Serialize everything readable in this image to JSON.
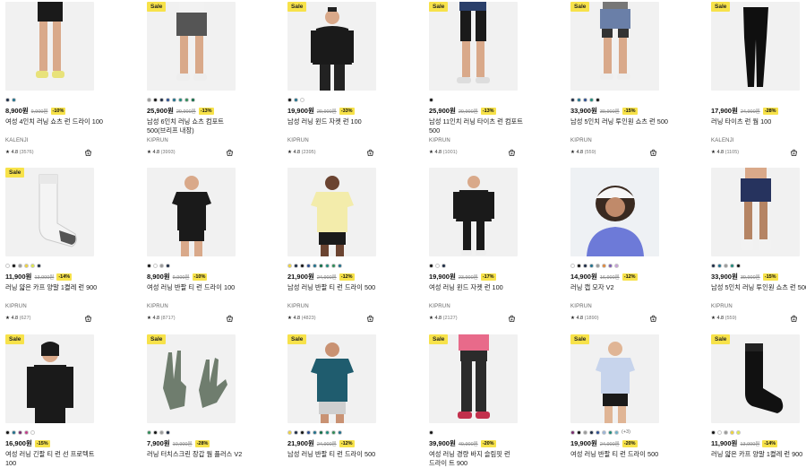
{
  "sale_badge": "Sale",
  "products": [
    {
      "sale": false,
      "price": "8,900원",
      "old": "9,900원",
      "disc": "-10%",
      "name": "여성 4인치 러닝 쇼츠 런 드라이 100",
      "brand": "KALENJI",
      "rating": "★ 4.8",
      "reviews": "(3576)",
      "swatches": [
        "#1b2a44",
        "#1f6f8b"
      ],
      "art": "shorts-legs"
    },
    {
      "sale": true,
      "price": "25,900원",
      "old": "29,900원",
      "disc": "-13%",
      "name": "남성 6인치 러닝 쇼츠 컴포트 500(브리프 내장)",
      "brand": "KIPRUN",
      "rating": "★ 4.8",
      "reviews": "(3993)",
      "swatches": [
        "#9a9a9a",
        "#111111",
        "#1b2a44",
        "#2a4d8f",
        "#1f6f8b",
        "#1e8a7a",
        "#2e8b57",
        "#0f6b45"
      ],
      "art": "shorts-man"
    },
    {
      "sale": true,
      "price": "19,900원",
      "old": "29,900원",
      "disc": "-33%",
      "name": "남성 러닝 윈드 자켓 런 100",
      "brand": "KIPRUN",
      "rating": "★ 4.8",
      "reviews": "(2395)",
      "swatches": [
        "#111111",
        "#1f6f8b",
        "#ffffff"
      ],
      "art": "jacket-man"
    },
    {
      "sale": true,
      "price": "25,900원",
      "old": "29,900원",
      "disc": "-13%",
      "name": "남성 11인치 러닝 타이츠 런 컴포트 500",
      "brand": "KIPRUN",
      "rating": "★ 4.8",
      "reviews": "(1001)",
      "swatches": [
        "#111111"
      ],
      "art": "tights-legs"
    },
    {
      "sale": true,
      "price": "33,900원",
      "old": "39,900원",
      "disc": "-15%",
      "name": "남성 5인치 러닝 투인원 쇼츠 런 500",
      "brand": "KIPRUN",
      "rating": "★ 4.8",
      "reviews": "(559)",
      "swatches": [
        "#1b2a44",
        "#1f6f8b",
        "#2a4d8f",
        "#1e8a7a",
        "#111111"
      ],
      "art": "twoinone-legs"
    },
    {
      "sale": true,
      "price": "17,900원",
      "old": "24,900원",
      "disc": "-28%",
      "name": "러닝 타이츠 런 웜 100",
      "brand": "KALENJI",
      "rating": "★ 4.8",
      "reviews": "(1105)",
      "swatches": [],
      "art": "black-tights"
    },
    {
      "sale": true,
      "price": "11,900원",
      "old": "13,900원",
      "disc": "-14%",
      "name": "러닝 얇은 카프 양말 1켤레 런 900",
      "brand": "KIPRUN",
      "rating": "★ 4.8",
      "reviews": "(627)",
      "swatches": [
        "#ffffff",
        "#111111",
        "#9a9a9a",
        "#f0d33a",
        "#dfe94b",
        "#1b2a44"
      ],
      "art": "white-sock"
    },
    {
      "sale": false,
      "price": "8,900원",
      "old": "9,900원",
      "disc": "-10%",
      "name": "여성 러닝 반팔 티 런 드라이 100",
      "brand": "KIPRUN",
      "rating": "★ 4.8",
      "reviews": "(8717)",
      "swatches": [
        "#111111",
        "#ffffff",
        "#9a9a9a",
        "#1b2a44"
      ],
      "art": "woman-tee"
    },
    {
      "sale": false,
      "price": "21,900원",
      "old": "24,900원",
      "disc": "-12%",
      "name": "남성 러닝 반팔 티 런 드라이 500",
      "brand": "KIPRUN",
      "rating": "★ 4.8",
      "reviews": "(4823)",
      "swatches": [
        "#f0d33a",
        "#1b2a44",
        "#111111",
        "#2a4d8f",
        "#1f6f8b",
        "#0f6b45",
        "#1e8a7a",
        "#2e8b57",
        "#1f6f8b"
      ],
      "art": "man-yellow"
    },
    {
      "sale": false,
      "price": "19,900원",
      "old": "23,900원",
      "disc": "-17%",
      "name": "여성 러닝 윈드 자켓 런 100",
      "brand": "KIPRUN",
      "rating": "★ 4.8",
      "reviews": "(2127)",
      "swatches": [
        "#111111",
        "#ffffff",
        "#1b2a44"
      ],
      "art": "woman-jacket"
    },
    {
      "sale": false,
      "price": "14,900원",
      "old": "16,900원",
      "disc": "-12%",
      "name": "러닝 캡 모자 V2",
      "brand": "KIPRUN",
      "rating": "★ 4.8",
      "reviews": "(1890)",
      "swatches": [
        "#ffffff",
        "#111111",
        "#1b2a44",
        "#1f6f8b",
        "#9a9a9a",
        "#e0873a",
        "#7a5bb0",
        "#c7a0d8"
      ],
      "art": "woman-cap"
    },
    {
      "sale": false,
      "price": "33,900원",
      "old": "39,900원",
      "disc": "-15%",
      "name": "남성 5인치 러닝 투인원 쇼츠 런 500",
      "brand": "KIPRUN",
      "rating": "★ 4.8",
      "reviews": "(559)",
      "swatches": [
        "#1b2a44",
        "#1f6f8b",
        "#9a9a9a",
        "#1e8a7a",
        "#111111"
      ],
      "art": "twoinone-navy"
    },
    {
      "sale": true,
      "price": "16,900원",
      "old": "",
      "disc": "-15%",
      "name": "여성 러닝 긴팔 티 런 선 프로텍트 100",
      "brand": "",
      "rating": "",
      "reviews": "",
      "swatches": [
        "#111111",
        "#1f6f8b",
        "#7a2b6e",
        "#c23f8a",
        "#ffffff"
      ],
      "art": "woman-longsleeve"
    },
    {
      "sale": true,
      "price": "7,900원",
      "old": "10,900원",
      "disc": "-28%",
      "name": "러닝 터치스크린 장갑 웜 플러스 V2",
      "brand": "",
      "rating": "",
      "reviews": "",
      "swatches": [
        "#2e8b57",
        "#111111",
        "#9a9a9a",
        "#1b2a44"
      ],
      "art": "gloves"
    },
    {
      "sale": true,
      "price": "21,900원",
      "old": "24,900원",
      "disc": "-12%",
      "name": "남성 러닝 반팔 티 런 드라이 500",
      "brand": "",
      "rating": "",
      "reviews": "",
      "swatches": [
        "#f0d33a",
        "#1b2a44",
        "#111111",
        "#2a4d8f",
        "#1f6f8b",
        "#0f6b45",
        "#1e8a7a",
        "#2e8b57",
        "#1f6f8b"
      ],
      "art": "man-teal"
    },
    {
      "sale": true,
      "price": "39,900원",
      "old": "49,900원",
      "disc": "-20%",
      "name": "여성 러닝 경량 바지 슬림핏 런 드라이 트 900",
      "brand": "",
      "rating": "",
      "reviews": "",
      "swatches": [
        "#111111"
      ],
      "art": "woman-pants"
    },
    {
      "sale": true,
      "price": "19,900원",
      "old": "24,900원",
      "disc": "-20%",
      "name": "여성 러닝 반팔 티 런 드라이 500",
      "brand": "",
      "rating": "",
      "reviews": "",
      "swatches": [
        "#7a2b6e",
        "#111111",
        "#9a9a9a",
        "#1b2a44",
        "#2a4d8f",
        "#9bb5d8",
        "#1e8a7a",
        "#6fb0c8"
      ],
      "more": "(+3)",
      "art": "woman-lightblue"
    },
    {
      "sale": true,
      "price": "11,900원",
      "old": "13,900원",
      "disc": "-14%",
      "name": "러닝 얇은 카프 양말 1켤레 런 900",
      "brand": "",
      "rating": "",
      "reviews": "",
      "swatches": [
        "#111111",
        "#ffffff",
        "#9a9a9a",
        "#f0d33a",
        "#dfe94b"
      ],
      "art": "black-sock"
    }
  ]
}
